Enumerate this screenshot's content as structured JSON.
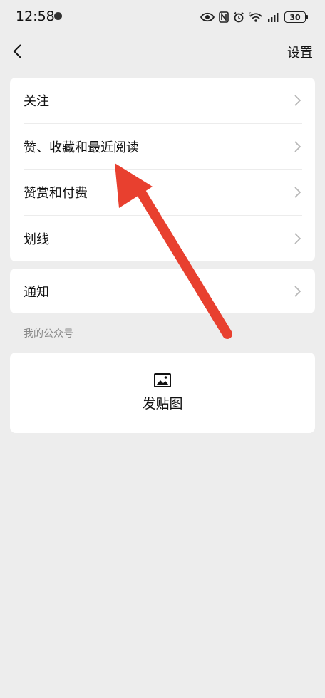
{
  "status_bar": {
    "time": "12:58",
    "battery": "30",
    "icons": [
      "eye-icon",
      "nfc-icon",
      "alarm-icon",
      "wifi-6-icon",
      "signal-icon",
      "battery-icon"
    ]
  },
  "header": {
    "back_icon": "chevron-left-icon",
    "settings_label": "设置"
  },
  "menu_group_1": {
    "items": [
      {
        "label": "关注"
      },
      {
        "label": "赞、收藏和最近阅读"
      },
      {
        "label": "赞赏和付费"
      },
      {
        "label": "划线"
      }
    ]
  },
  "menu_group_2": {
    "items": [
      {
        "label": "通知"
      }
    ]
  },
  "official_account": {
    "section_title": "我的公众号",
    "post_image_label": "发贴图",
    "post_image_icon": "image-icon"
  },
  "annotation": {
    "arrow_color": "#e8402f"
  },
  "colors": {
    "background": "#ededed",
    "card": "#ffffff",
    "chevron": "#b8b8b8"
  }
}
